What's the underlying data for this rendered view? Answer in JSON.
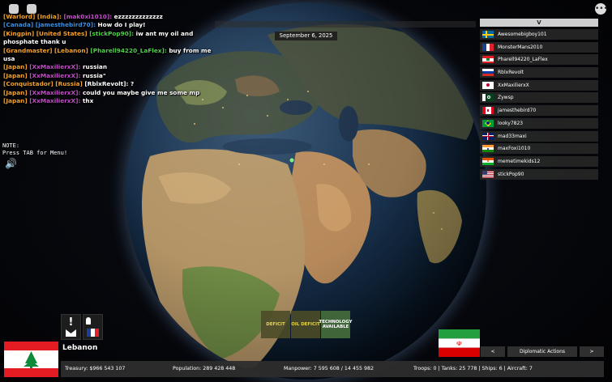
{
  "date": "September 6, 2025",
  "chat": [
    {
      "segments": [
        {
          "t": "[Warlord] [India]:",
          "c": "#f2a12e"
        },
        {
          "t": " [mak0xi1010]:",
          "c": "#c24fc7"
        },
        {
          "t": " ezzzzzzzzzzzzz",
          "c": "#ffffff"
        }
      ]
    },
    {
      "segments": [
        {
          "t": "[Canada]",
          "c": "#3b8fe0"
        },
        {
          "t": " [jamesthebird70]:",
          "c": "#3b8fe0"
        },
        {
          "t": " How do I play!",
          "c": "#ffffff"
        }
      ]
    },
    {
      "segments": [
        {
          "t": "[Kingpin] [United States]",
          "c": "#f2a12e"
        },
        {
          "t": " [stickPop90]:",
          "c": "#4fcf4a"
        },
        {
          "t": " iw ant my oil and phosphate thank u",
          "c": "#ffffff"
        }
      ]
    },
    {
      "segments": [
        {
          "t": "[Grandmaster] [Lebanon]",
          "c": "#f2a12e"
        },
        {
          "t": " [Pharell94220_LaFlex]:",
          "c": "#4fcf4a"
        },
        {
          "t": " buy from me usa",
          "c": "#ffffff"
        }
      ]
    },
    {
      "segments": [
        {
          "t": "[Japan]",
          "c": "#f2a12e"
        },
        {
          "t": " [XxMaxilierxX]:",
          "c": "#c24fc7"
        },
        {
          "t": " russian",
          "c": "#ffffff"
        }
      ]
    },
    {
      "segments": [
        {
          "t": "[Japan]",
          "c": "#f2a12e"
        },
        {
          "t": " [XxMaxilierxX]:",
          "c": "#c24fc7"
        },
        {
          "t": " russia\"",
          "c": "#ffffff"
        }
      ]
    },
    {
      "segments": [
        {
          "t": "[Conquistador] [Russia]",
          "c": "#f2a12e"
        },
        {
          "t": " [RblxRevolt]:",
          "c": "#ffffff"
        },
        {
          "t": " ?",
          "c": "#ffffff"
        }
      ]
    },
    {
      "segments": [
        {
          "t": "[Japan]",
          "c": "#f2a12e"
        },
        {
          "t": " [XxMaxilierxX]:",
          "c": "#c24fc7"
        },
        {
          "t": " could you maybe give me some mp",
          "c": "#ffffff"
        }
      ]
    },
    {
      "segments": [
        {
          "t": "[Japan]",
          "c": "#f2a12e"
        },
        {
          "t": " [XxMaxilierxX]:",
          "c": "#c24fc7"
        },
        {
          "t": " thx",
          "c": "#ffffff"
        }
      ]
    }
  ],
  "note": {
    "line1": "NOTE:",
    "line2": "Press TAB for Menu!"
  },
  "players_header": "V",
  "players": [
    {
      "name": "Awesomebigboy101",
      "flag": "sweden"
    },
    {
      "name": "MonsterMans2010",
      "flag": "france"
    },
    {
      "name": "Pharell94220_LaFlex",
      "flag": "lebanon"
    },
    {
      "name": "RblxRevolt",
      "flag": "russia"
    },
    {
      "name": "XxMaxilierxX",
      "flag": "japan"
    },
    {
      "name": "Zywsp",
      "flag": "pakistan"
    },
    {
      "name": "jamesthebird70",
      "flag": "canada"
    },
    {
      "name": "looky7823",
      "flag": "brazil"
    },
    {
      "name": "mad33maxi",
      "flag": "uk"
    },
    {
      "name": "maxFoxi1010",
      "flag": "india"
    },
    {
      "name": "memetimekids12",
      "flag": "niger"
    },
    {
      "name": "stickPop90",
      "flag": "usa"
    }
  ],
  "my_country": {
    "name": "Lebanon"
  },
  "status_boxes": [
    {
      "label": "DEFICIT",
      "kind": "def"
    },
    {
      "label": "OIL DEFICIT",
      "kind": "def"
    },
    {
      "label": "TECHNOLOGY AVAILABLE",
      "kind": "tech"
    }
  ],
  "diplomacy": {
    "prev": "<",
    "label": "Diplomatic Actions",
    "next": ">"
  },
  "stats": {
    "treasury": "Treasury:  $966 543 107",
    "population": "Population: 289 428 448",
    "manpower": "Manpower:  7 595 608  /  14 455 982",
    "troops": "Troops: 0  |  Tanks: 25 778  |  Ships: 6  |  Aircraft: 7"
  },
  "colors": {
    "accent_orange": "#f2a12e",
    "tech_green": "#466e3c",
    "deficit_yellow": "#e9d64a"
  }
}
